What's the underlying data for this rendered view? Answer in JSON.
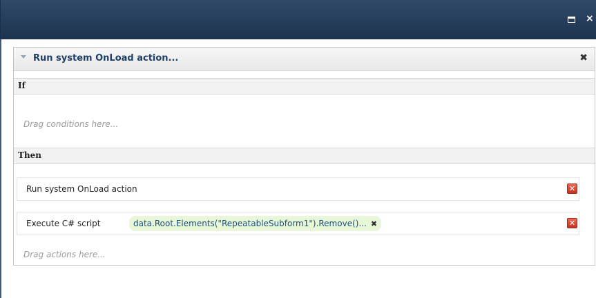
{
  "window": {
    "maximize_icon": "maximize-icon",
    "close_icon": "close-icon",
    "close_glyph": "×"
  },
  "rule": {
    "title": "Run system OnLoad action...",
    "close_glyph": "✖",
    "if_label": "If",
    "conditions_placeholder": "Drag conditions here...",
    "then_label": "Then",
    "actions": [
      {
        "label": "Run system OnLoad action",
        "delete_glyph": "✕"
      },
      {
        "label": "Execute C# script",
        "argument": "data.Root.Elements(\"RepeatableSubform1\").Remove()...",
        "argument_remove_glyph": "✖",
        "delete_glyph": "✕"
      }
    ],
    "actions_placeholder": "Drag actions here..."
  },
  "colors": {
    "titlebar": "#1d3350",
    "rule_title": "#1f3f66",
    "chip_bg": "#e8f7d7",
    "delete_icon": "#d8412b"
  }
}
